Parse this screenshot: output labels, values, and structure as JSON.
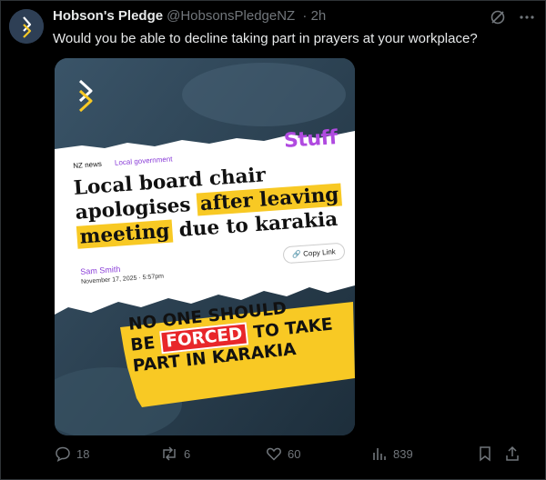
{
  "author": {
    "name": "Hobson's Pledge",
    "handle": "@HobsonsPledgeNZ",
    "time": "· 2h"
  },
  "tweet": {
    "text": "Would you be able to decline taking part in prayers at your workplace?"
  },
  "image": {
    "brand": "Stuff",
    "section": "NZ news",
    "subsection": "Local government",
    "headline_part1": "Local board chair apologises",
    "headline_hl1": "after leaving",
    "headline_hl2": "meeting",
    "headline_part2": "due to karakia",
    "copy_link": "Copy Link",
    "author": "Sam Smith",
    "date": "November 17, 2025 · 5:57pm",
    "banner_line1": "NO ONE SHOULD",
    "banner_be": "BE",
    "banner_forced": "FORCED",
    "banner_line2_end": "TO TAKE",
    "banner_line3": "PART IN KARAKIA"
  },
  "actions": {
    "replies": "18",
    "reposts": "6",
    "likes": "60",
    "views": "839"
  },
  "colors": {
    "highlight": "#f8c924",
    "accent": "#8b3fd8",
    "forced": "#e8262a",
    "muted": "#71767b"
  }
}
